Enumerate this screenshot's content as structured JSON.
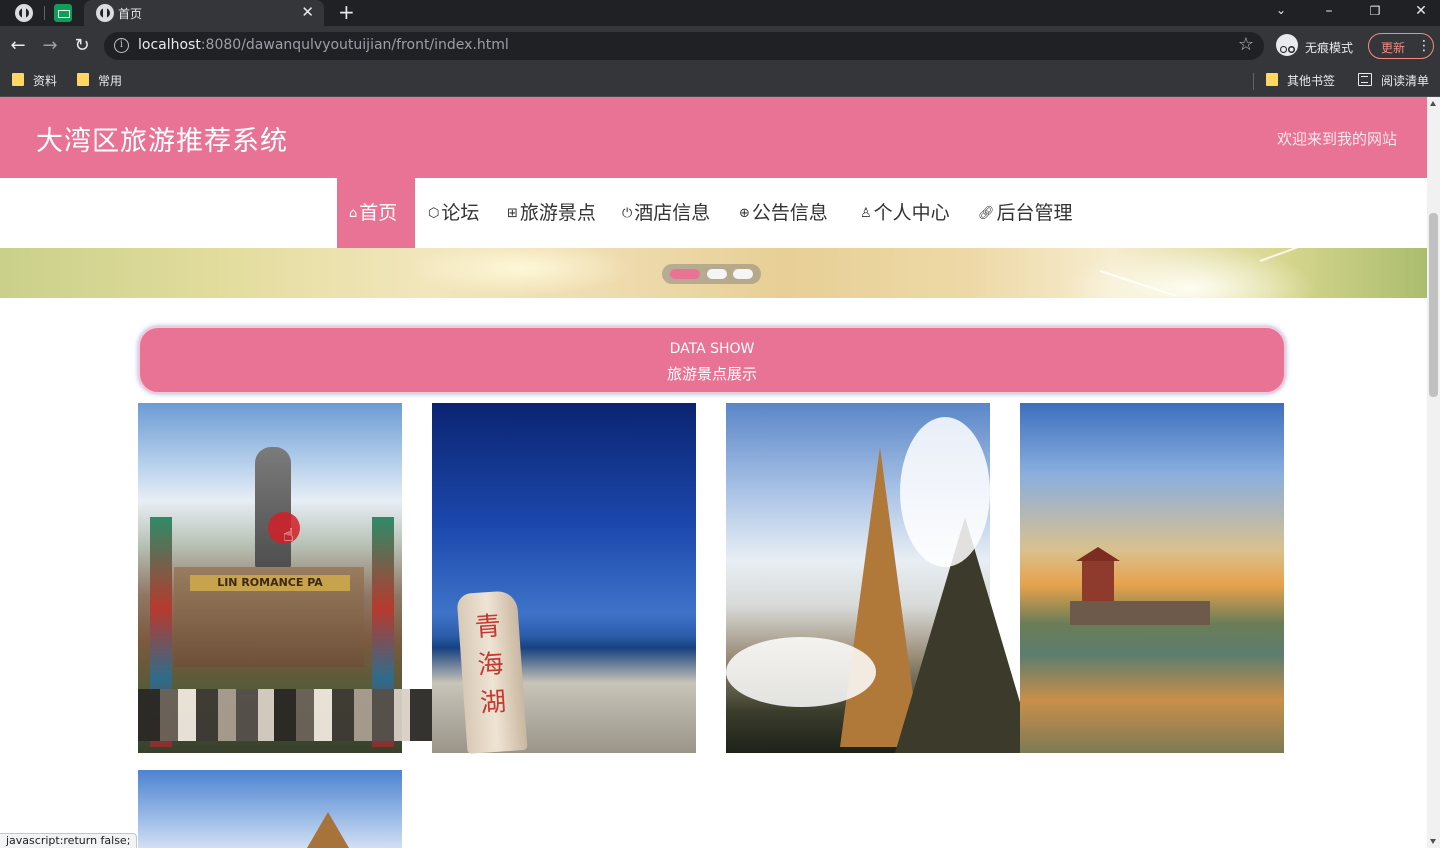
{
  "browser": {
    "active_tab_title": "首页",
    "url_host": "localhost",
    "url_rest": ":8080/dawanqulvyoutuijian/front/index.html",
    "incognito_label": "无痕模式",
    "update_label": "更新",
    "bookmarks": [
      "资料",
      "常用"
    ],
    "other_bookmarks": "其他书签",
    "reading_list": "阅读清单"
  },
  "site": {
    "title": "大湾区旅游推荐系统",
    "welcome": "欢迎来到我的网站"
  },
  "nav": [
    {
      "icon": "home-icon",
      "label": "首页",
      "active": true
    },
    {
      "icon": "forum-icon",
      "label": "论坛",
      "active": false
    },
    {
      "icon": "attractions-icon",
      "label": "旅游景点",
      "active": false
    },
    {
      "icon": "hotel-icon",
      "label": "酒店信息",
      "active": false
    },
    {
      "icon": "notice-icon",
      "label": "公告信息",
      "active": false
    },
    {
      "icon": "user-icon",
      "label": "个人中心",
      "active": false
    },
    {
      "icon": "link-icon",
      "label": "后台管理",
      "active": false
    }
  ],
  "carousel": {
    "slides": 3,
    "active": 1
  },
  "section": {
    "title_en": "DATA SHOW",
    "title_cn": "旅游景点展示"
  },
  "cards": {
    "gate_sign": "LIN ROMANCE PA",
    "stele_chars": [
      "青",
      "海",
      "湖"
    ]
  },
  "status_bar": "javascript:return false;",
  "colors": {
    "brand_pink": "#e87395",
    "chrome_dark": "#202124",
    "chrome_toolbar": "#35363a"
  }
}
